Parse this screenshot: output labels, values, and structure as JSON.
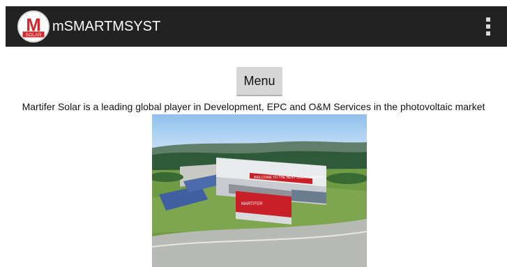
{
  "app": {
    "title": "mSMARTMSYST",
    "logo_letter": "M",
    "logo_text": "SOLAR"
  },
  "actions": {
    "overflow_icon": "more-vert-icon"
  },
  "main": {
    "menu_label": "Menu",
    "description": "Martifer Solar is a leading global player in Development, EPC and O&M Services in the photovoltaic market",
    "image_sign_text": "WELCOME TO THE BEST SOLAR ENERGY",
    "image_building_text": "MARTIFER"
  },
  "colors": {
    "actionbar": "#222222",
    "logo_red": "#d7262a",
    "button": "#d6d6d6"
  }
}
